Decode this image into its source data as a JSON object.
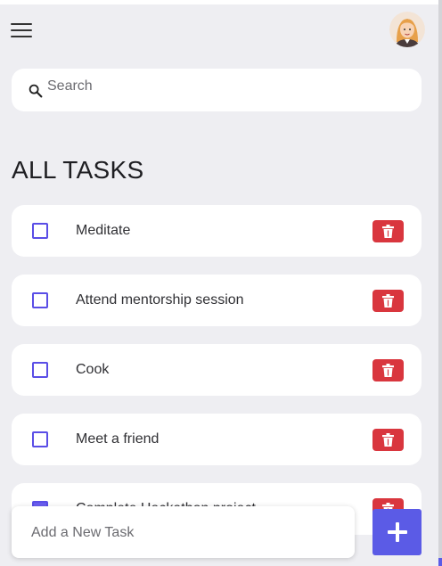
{
  "header": {
    "menu_icon": "hamburger-menu-icon",
    "avatar_icon": "user-avatar"
  },
  "search": {
    "placeholder": "Search",
    "value": "",
    "icon": "search-icon"
  },
  "section_title": "ALL TASKS",
  "tasks": [
    {
      "label": "Meditate",
      "checked": false
    },
    {
      "label": "Attend mentorship session",
      "checked": false
    },
    {
      "label": "Cook",
      "checked": false
    },
    {
      "label": "Meet a friend",
      "checked": false
    },
    {
      "label": "Complete Hackathon project",
      "checked": true
    }
  ],
  "new_task": {
    "placeholder": "Add a New Task",
    "value": "",
    "add_icon": "plus-icon"
  },
  "colors": {
    "accent": "#5b5be6",
    "delete": "#d9363e",
    "background": "#eeeef2",
    "card": "#ffffff"
  }
}
